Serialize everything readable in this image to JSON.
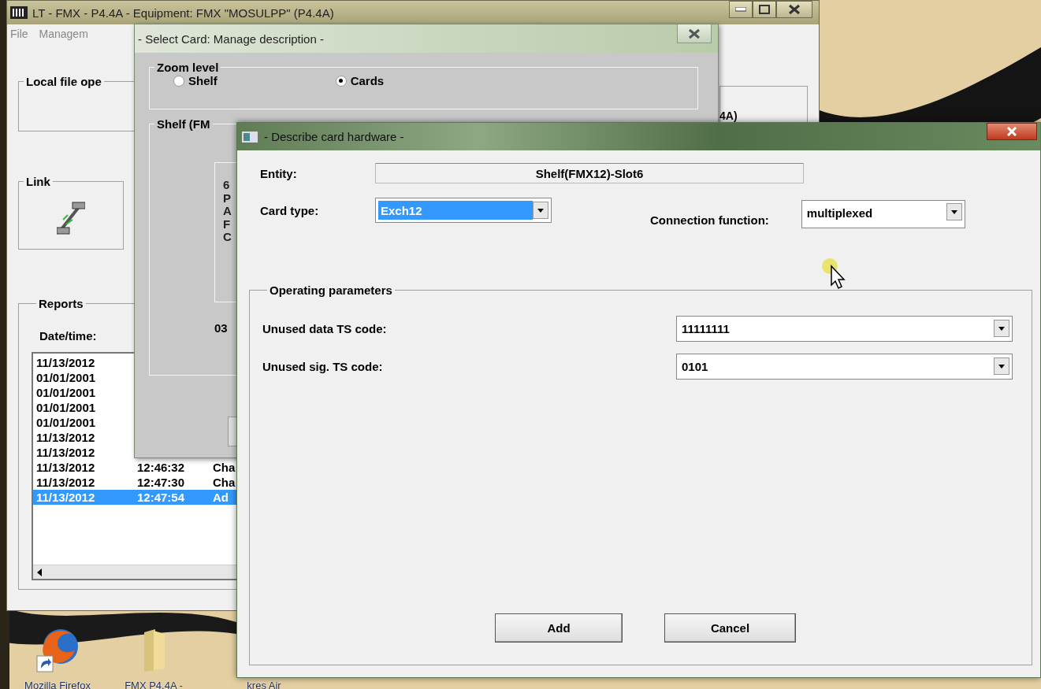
{
  "desktop": {
    "icons": [
      {
        "kind": "browser",
        "label": "Mozilla Firefox"
      },
      {
        "kind": "folder",
        "label": "FMX P4.4A -"
      },
      {
        "kind": "none",
        "label": "kres Air"
      }
    ]
  },
  "main_window": {
    "title": "LT - FMX - P4.4A - Equipment: FMX \"MOSULPP\" (P4.4A)",
    "menu": [
      "File",
      "Managem"
    ],
    "local_file_group": {
      "label": "Local file ope"
    },
    "link_group": {
      "label": "Link"
    },
    "side_text": "4A)",
    "reports": {
      "label": "Reports",
      "column_label": "Date/time:",
      "rows": [
        {
          "date": "11/13/2012",
          "selected": false
        },
        {
          "date": "01/01/2001",
          "selected": false
        },
        {
          "date": "01/01/2001",
          "selected": false
        },
        {
          "date": "01/01/2001",
          "selected": false
        },
        {
          "date": "01/01/2001",
          "selected": false
        },
        {
          "date": "11/13/2012",
          "selected": false
        },
        {
          "date": "11/13/2012",
          "selected": false
        },
        {
          "date": "11/13/2012",
          "time": "12:46:32",
          "text": "Cha",
          "selected": false
        },
        {
          "date": "11/13/2012",
          "time": "12:47:30",
          "text": "Cha",
          "selected": false
        },
        {
          "date": "11/13/2012",
          "time": "12:47:54",
          "text": "Ad",
          "selected": true
        }
      ]
    }
  },
  "select_card_window": {
    "title": "- Select Card: Manage description -",
    "zoom_level": {
      "label": "Zoom level",
      "options": [
        {
          "label": "Shelf",
          "selected": false
        },
        {
          "label": "Cards",
          "selected": true
        }
      ]
    },
    "shelf_group": {
      "label": "Shelf (FM",
      "card_label": "6PAFC",
      "slot": "03"
    }
  },
  "describe_dialog": {
    "title": "- Describe card hardware -",
    "entity": {
      "label": "Entity:",
      "value": "Shelf(FMX12)-Slot6"
    },
    "card_type": {
      "label": "Card type:",
      "value": "Exch12",
      "highlighted": true
    },
    "connection_function": {
      "label": "Connection function:",
      "value": "multiplexed",
      "highlighted": false
    },
    "operating_parameters": {
      "label": "Operating parameters",
      "rows": [
        {
          "label": "Unused data TS code:",
          "value": "11111111"
        },
        {
          "label": "Unused sig. TS code:",
          "value": "0101"
        }
      ]
    },
    "buttons": [
      "Add",
      "Cancel"
    ]
  }
}
